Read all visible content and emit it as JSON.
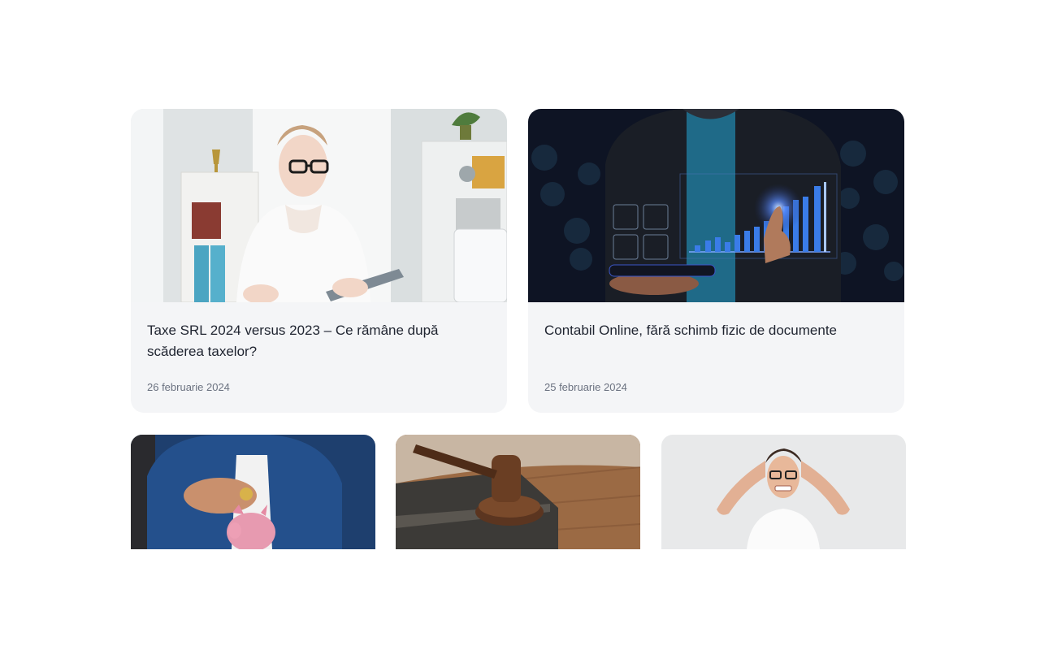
{
  "posts": [
    {
      "title": "Taxe SRL 2024 versus 2023 – Ce rămâne după scăderea taxelor?",
      "date": "26 februarie 2024"
    },
    {
      "title": "Contabil Online, fără schimb fizic de documente",
      "date": "25 februarie 2024"
    }
  ],
  "colors": {
    "card_bg": "#f4f5f7",
    "title": "#1f2430",
    "date": "#6b7280"
  }
}
